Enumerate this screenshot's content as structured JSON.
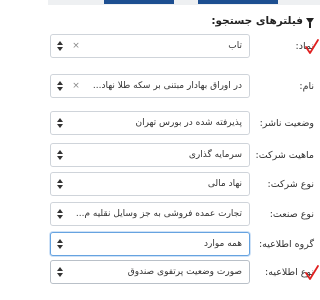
{
  "panel": {
    "title": "فیلترهای جستجو:"
  },
  "fields": [
    {
      "label": "نماد:",
      "value": "تاب"
    },
    {
      "label": "نام:",
      "value": "در اوراق بهادار مبتنی بر سکه طلا نهاد..."
    },
    {
      "label": "وضعیت ناشر:",
      "value": "پذیرفته شده در بورس تهران"
    },
    {
      "label": "ماهیت شرکت:",
      "value": "سرمایه گذاری"
    },
    {
      "label": "نوع شرکت:",
      "value": "نهاد مالی"
    },
    {
      "label": "نوع صنعت:",
      "value": "تجارت عمده فروشی به جز وسایل نقلیه م..."
    },
    {
      "label": "گروه اطلاعیه:",
      "value": "همه موارد"
    },
    {
      "label": "نوع اطلاعیه:",
      "value": "صورت وضعیت پرتفوی صندوق"
    }
  ],
  "icons": {
    "clear": "×",
    "filter": "filter-icon",
    "caret": "up-down-caret-icon",
    "check": "check-icon"
  },
  "colors": {
    "brand": "#1d4f91",
    "focus_border": "#66a3e0",
    "annotation_check": "#e02020"
  }
}
